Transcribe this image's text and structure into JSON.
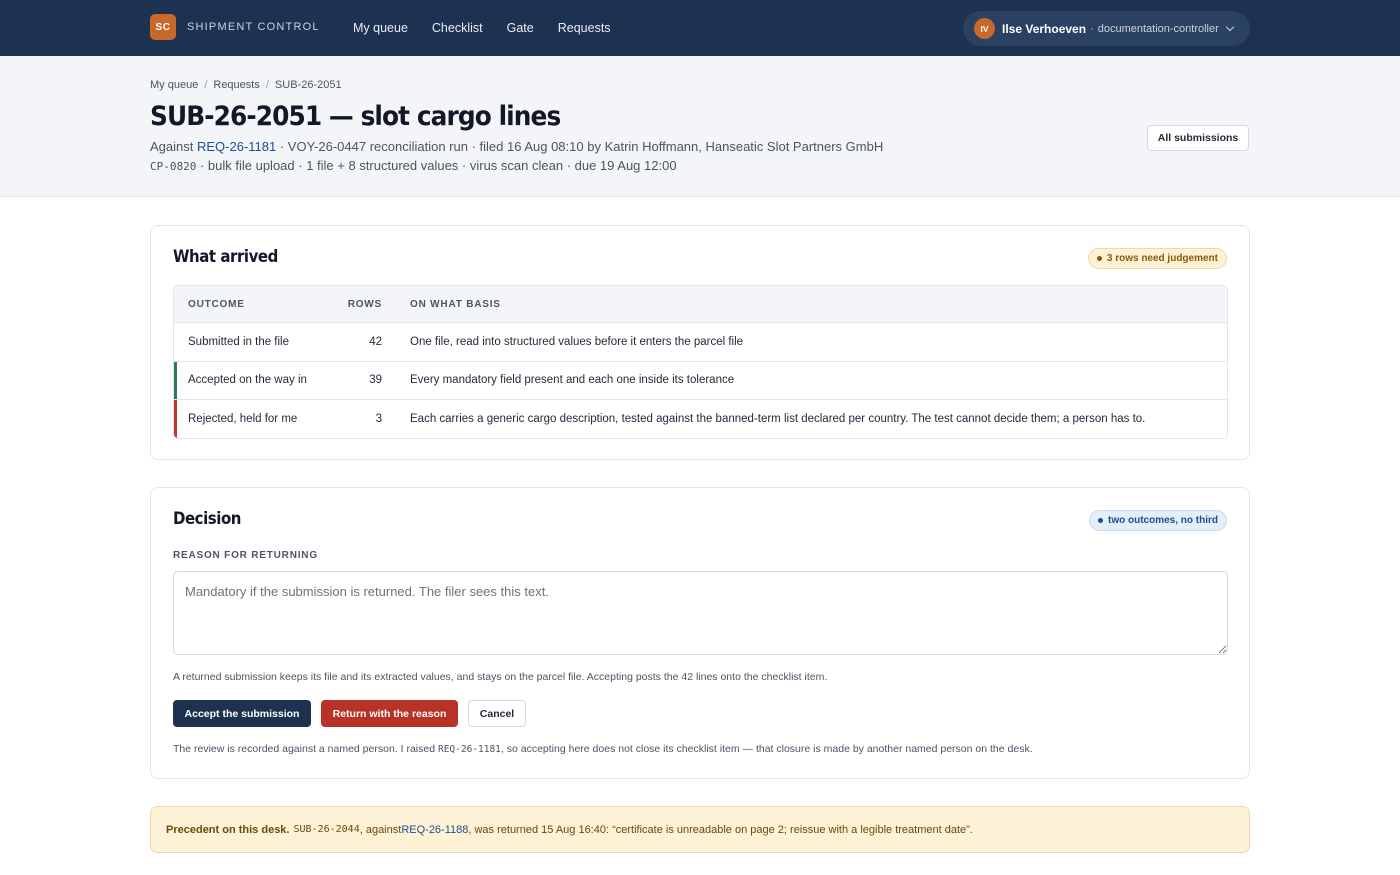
{
  "brand": {
    "mark": "SC",
    "name": "SHIPMENT CONTROL"
  },
  "nav": {
    "items": [
      "My queue",
      "Checklist",
      "Gate",
      "Requests"
    ]
  },
  "user": {
    "initials": "IV",
    "name": "Ilse Verhoeven",
    "separator": "·",
    "role": "documentation-controller"
  },
  "breadcrumb": {
    "items": [
      "My queue",
      "Requests",
      "SUB-26-2051"
    ],
    "separator": "/"
  },
  "page": {
    "title": "SUB-26-2051 — slot cargo lines",
    "meta1": {
      "prefix": "Against ",
      "request_link": "REQ-26-1181",
      "rest": " · VOY-26-0447 reconciliation run · filed 16 Aug 08:10 by Katrin Hoffmann, Hanseatic Slot Partners GmbH"
    },
    "meta2": {
      "code": "CP-0820",
      "rest": " · bulk file upload · 1 file + 8 structured values · virus scan clean · due 19 Aug 12:00"
    },
    "all_submissions_label": "All submissions"
  },
  "arrived": {
    "title": "What arrived",
    "badge": "3 rows need judgement",
    "columns": [
      "OUTCOME",
      "ROWS",
      "ON WHAT BASIS"
    ],
    "rows": [
      {
        "outcome": "Submitted in the file",
        "rows": "42",
        "basis": "One file, read into structured values before it enters the parcel file",
        "status": "neutral"
      },
      {
        "outcome": "Accepted on the way in",
        "rows": "39",
        "basis": "Every mandatory field present and each one inside its tolerance",
        "status": "accepted"
      },
      {
        "outcome": "Rejected, held for me",
        "rows": "3",
        "basis": "Each carries a generic cargo description, tested against the banned-term list declared per country. The test cannot decide them; a person has to.",
        "status": "rejected"
      }
    ]
  },
  "decision": {
    "title": "Decision",
    "badge": "two outcomes, no third",
    "reason_label": "REASON FOR RETURNING",
    "reason_placeholder": "Mandatory if the submission is returned. The filer sees this text.",
    "reason_value": "",
    "note": "A returned submission keeps its file and its extracted values, and stays on the parcel file. Accepting posts the 42 lines onto the checklist item.",
    "accept_label": "Accept the submission",
    "return_label": "Return with the reason",
    "cancel_label": "Cancel",
    "footer": {
      "prefix": "The review is recorded against a named person. I raised ",
      "code": "REQ-26-1181",
      "rest": ", so accepting here does not close its checklist item — that closure is made by another named person on the desk."
    }
  },
  "precedent": {
    "label": "Precedent on this desk.",
    "code": "SUB-26-2044",
    "mid": ", against ",
    "link": "REQ-26-1188",
    "rest": ", was returned 15 Aug 16:40: “certificate is unreadable on page 2; reissue with a legible treatment date”."
  },
  "colors": {
    "nav_bg": "#1d3250",
    "accent": "#c8692c",
    "accepted": "#2f7d4f",
    "rejected": "#c0392b",
    "primary_button": "#1d3250",
    "danger_button": "#b83227"
  }
}
